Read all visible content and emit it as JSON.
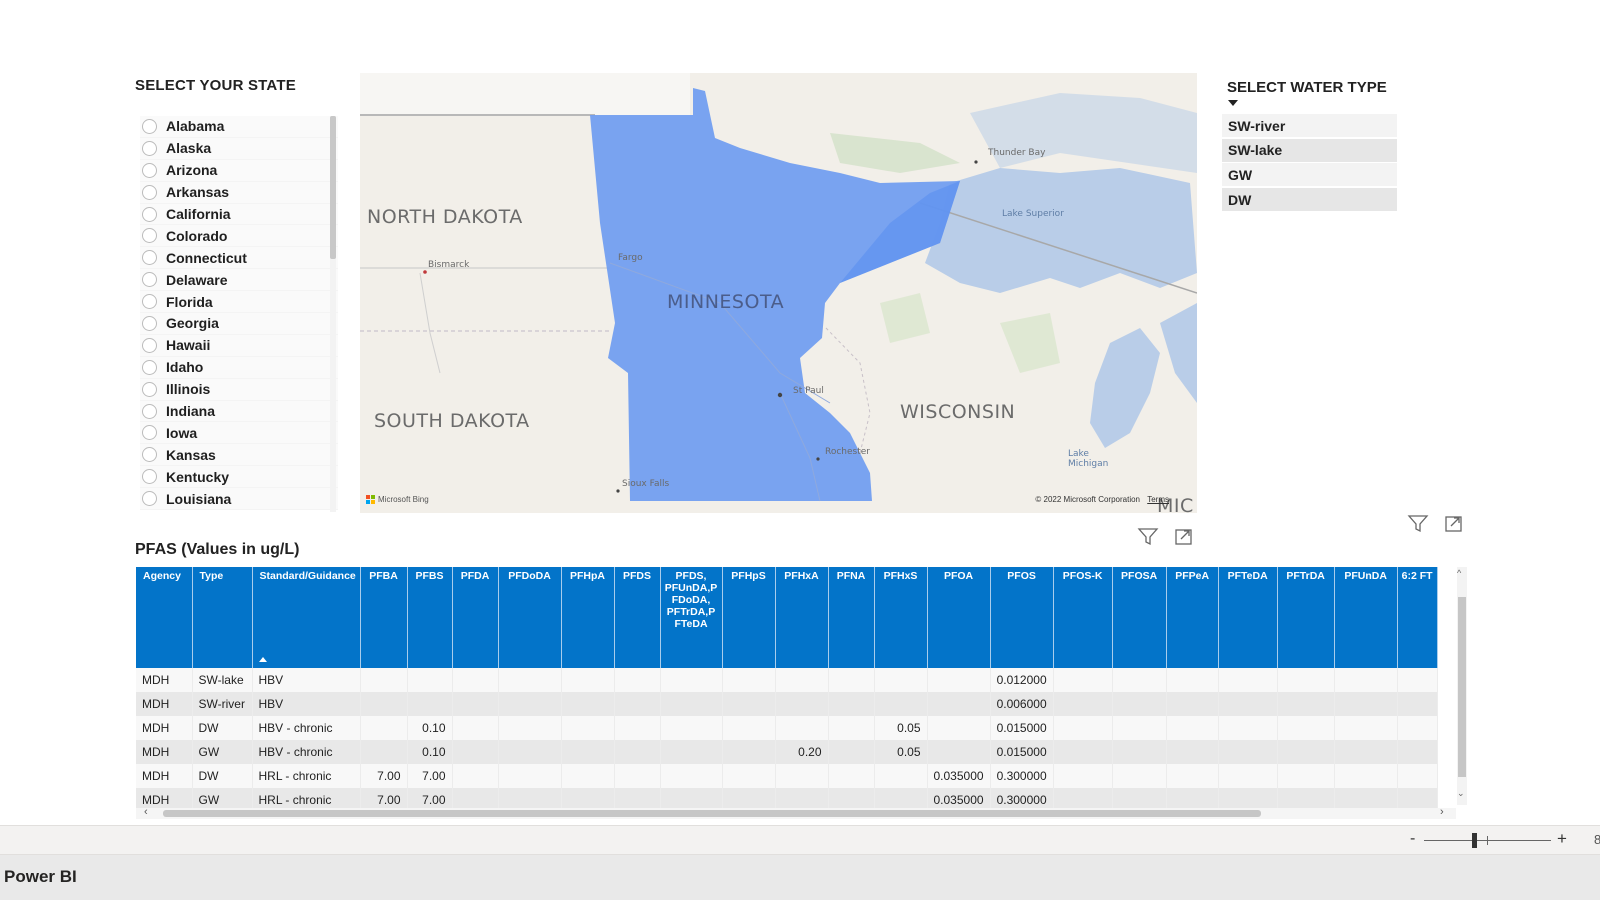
{
  "state_slicer": {
    "title": "SELECT YOUR STATE",
    "items": [
      "Alabama",
      "Alaska",
      "Arizona",
      "Arkansas",
      "California",
      "Colorado",
      "Connecticut",
      "Delaware",
      "Florida",
      "Georgia",
      "Hawaii",
      "Idaho",
      "Illinois",
      "Indiana",
      "Iowa",
      "Kansas",
      "Kentucky",
      "Louisiana"
    ]
  },
  "map": {
    "labels": {
      "north_dakota": "NORTH DAKOTA",
      "south_dakota": "SOUTH DAKOTA",
      "minnesota": "MINNESOTA",
      "wisconsin": "WISCONSIN",
      "michigan_partial": "MIC",
      "bismarck": "Bismarck",
      "fargo": "Fargo",
      "st_paul": "St Paul",
      "rochester": "Rochester",
      "sioux_falls": "Sioux Falls",
      "thunder_bay": "Thunder Bay",
      "lake_superior": "Lake Superior",
      "lake_michigan": "Lake Michigan"
    },
    "attribution": "Microsoft Bing",
    "copyright": "© 2022 Microsoft Corporation",
    "terms": "Terms",
    "selected_color": "#6f9cf0"
  },
  "water_slicer": {
    "title": "SELECT WATER TYPE",
    "items": [
      "SW-river",
      "SW-lake",
      "GW",
      "DW"
    ]
  },
  "table": {
    "title": "PFAS (Values in ug/L)",
    "columns": [
      "Agency",
      "Type",
      "Standard/Guidance",
      "PFBA",
      "PFBS",
      "PFDA",
      "PFDoDA",
      "PFHpA",
      "PFDS",
      "PFDS, PFUnDA,P FDoDA, PFTrDA,P FTeDA",
      "PFHpS",
      "PFHxA",
      "PFNA",
      "PFHxS",
      "PFOA",
      "PFOS",
      "PFOS-K",
      "PFOSA",
      "PFPeA",
      "PFTeDA",
      "PFTrDA",
      "PFUnDA",
      "6:2 FT"
    ],
    "rows": [
      [
        "MDH",
        "SW-lake",
        "HBV",
        "",
        "",
        "",
        "",
        "",
        "",
        "",
        "",
        "",
        "",
        "",
        "",
        "0.012000",
        "",
        "",
        "",
        "",
        "",
        "",
        ""
      ],
      [
        "MDH",
        "SW-river",
        "HBV",
        "",
        "",
        "",
        "",
        "",
        "",
        "",
        "",
        "",
        "",
        "",
        "",
        "0.006000",
        "",
        "",
        "",
        "",
        "",
        "",
        ""
      ],
      [
        "MDH",
        "DW",
        "HBV - chronic",
        "",
        "0.10",
        "",
        "",
        "",
        "",
        "",
        "",
        "",
        "",
        "0.05",
        "",
        "0.015000",
        "",
        "",
        "",
        "",
        "",
        "",
        ""
      ],
      [
        "MDH",
        "GW",
        "HBV - chronic",
        "",
        "0.10",
        "",
        "",
        "",
        "",
        "",
        "",
        "0.20",
        "",
        "0.05",
        "",
        "0.015000",
        "",
        "",
        "",
        "",
        "",
        "",
        ""
      ],
      [
        "MDH",
        "DW",
        "HRL - chronic",
        "7.00",
        "7.00",
        "",
        "",
        "",
        "",
        "",
        "",
        "",
        "",
        "",
        "0.035000",
        "0.300000",
        "",
        "",
        "",
        "",
        "",
        "",
        ""
      ],
      [
        "MDH",
        "GW",
        "HRL - chronic",
        "7.00",
        "7.00",
        "",
        "",
        "",
        "",
        "",
        "",
        "",
        "",
        "",
        "0.035000",
        "0.300000",
        "",
        "",
        "",
        "",
        "",
        "",
        ""
      ]
    ],
    "header_color": "#0374c9"
  },
  "zoom": {
    "minus": "-",
    "plus": "+",
    "level": "8"
  },
  "footer": {
    "brand": "Power BI"
  }
}
